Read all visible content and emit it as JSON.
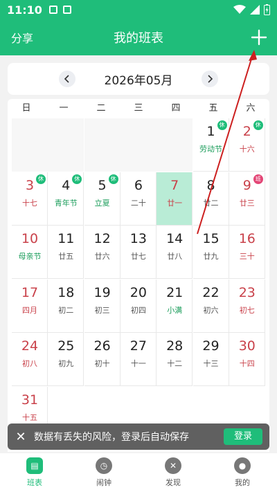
{
  "status": {
    "time": "11:10"
  },
  "appbar": {
    "share_label": "分享",
    "title": "我的班表"
  },
  "month_nav": {
    "current": "2026年05月"
  },
  "weekdays": [
    "日",
    "一",
    "二",
    "三",
    "四",
    "五",
    "六"
  ],
  "days": [
    {
      "num": "1",
      "sub": "劳动节",
      "style": "green-sub",
      "badge": "休"
    },
    {
      "num": "2",
      "sub": "十六",
      "style": "red",
      "badge": "休"
    },
    {
      "num": "3",
      "sub": "十七",
      "style": "red",
      "badge": "休"
    },
    {
      "num": "4",
      "sub": "青年节",
      "style": "green-sub",
      "badge": "休"
    },
    {
      "num": "5",
      "sub": "立夏",
      "style": "green-sub",
      "badge": "休"
    },
    {
      "num": "6",
      "sub": "二十",
      "style": ""
    },
    {
      "num": "7",
      "sub": "廿一",
      "style": "red",
      "selected": true
    },
    {
      "num": "8",
      "sub": "廿二",
      "style": ""
    },
    {
      "num": "9",
      "sub": "廿三",
      "style": "red",
      "badge": "班",
      "badge_type": "work"
    },
    {
      "num": "10",
      "sub": "母亲节",
      "style": "red-green"
    },
    {
      "num": "11",
      "sub": "廿五",
      "style": ""
    },
    {
      "num": "12",
      "sub": "廿六",
      "style": ""
    },
    {
      "num": "13",
      "sub": "廿七",
      "style": ""
    },
    {
      "num": "14",
      "sub": "廿八",
      "style": ""
    },
    {
      "num": "15",
      "sub": "廿九",
      "style": ""
    },
    {
      "num": "16",
      "sub": "三十",
      "style": "red"
    },
    {
      "num": "17",
      "sub": "四月",
      "style": "red"
    },
    {
      "num": "18",
      "sub": "初二",
      "style": ""
    },
    {
      "num": "19",
      "sub": "初三",
      "style": ""
    },
    {
      "num": "20",
      "sub": "初四",
      "style": ""
    },
    {
      "num": "21",
      "sub": "小满",
      "style": "green-sub"
    },
    {
      "num": "22",
      "sub": "初六",
      "style": ""
    },
    {
      "num": "23",
      "sub": "初七",
      "style": "red"
    },
    {
      "num": "24",
      "sub": "初八",
      "style": "red"
    },
    {
      "num": "25",
      "sub": "初九",
      "style": ""
    },
    {
      "num": "26",
      "sub": "初十",
      "style": ""
    },
    {
      "num": "27",
      "sub": "十一",
      "style": ""
    },
    {
      "num": "28",
      "sub": "十二",
      "style": ""
    },
    {
      "num": "29",
      "sub": "十三",
      "style": ""
    },
    {
      "num": "30",
      "sub": "十四",
      "style": "red"
    },
    {
      "num": "31",
      "sub": "十五",
      "style": "red"
    }
  ],
  "first_weekday": 5,
  "snackbar": {
    "message": "数据有丢失的风险，登录后自动保存",
    "action": "登录"
  },
  "tabs": [
    {
      "label": "班表",
      "icon": "calendar-icon",
      "active": true
    },
    {
      "label": "闹钟",
      "icon": "clock-icon",
      "active": false
    },
    {
      "label": "发现",
      "icon": "discover-icon",
      "active": false
    },
    {
      "label": "我的",
      "icon": "profile-icon",
      "active": false
    }
  ],
  "colors": {
    "brand": "#1fbd7a",
    "holiday_red": "#c9414a",
    "work_pink": "#e34676",
    "selected": "#b9ecd6"
  }
}
